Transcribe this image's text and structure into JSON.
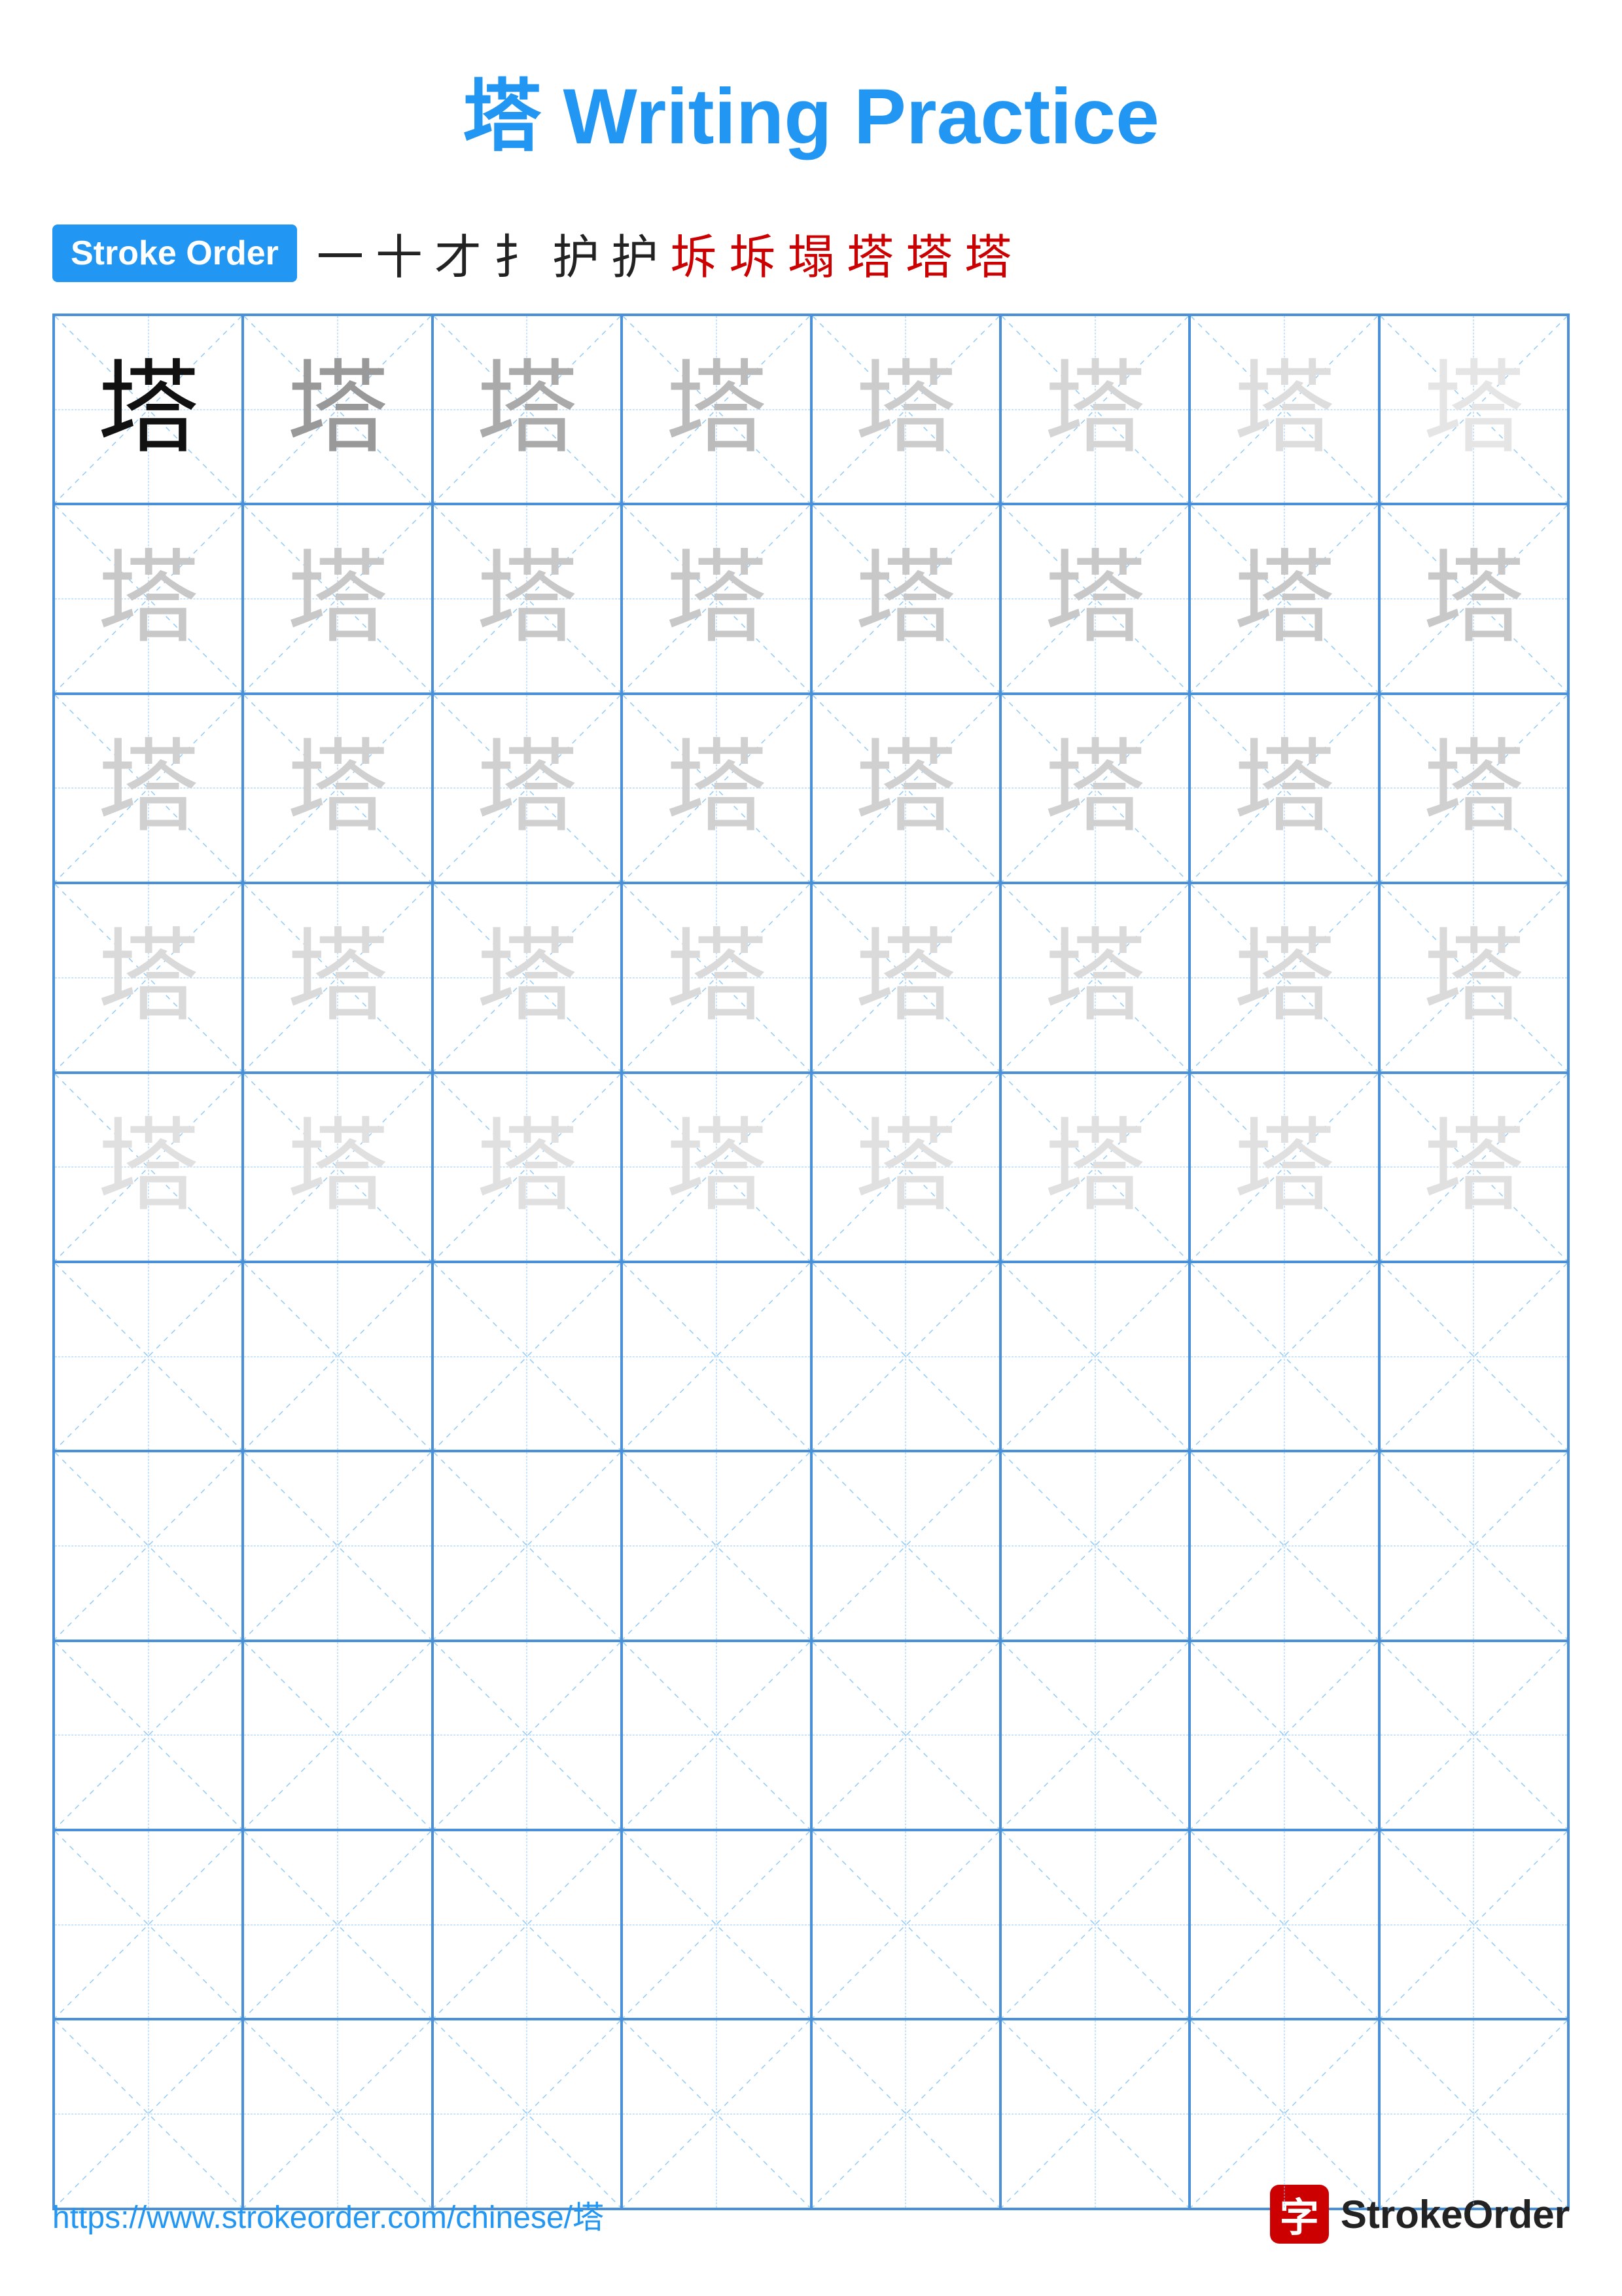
{
  "title": {
    "char": "塔",
    "subtitle": "Writing Practice",
    "full": "塔 Writing Practice"
  },
  "stroke_order": {
    "badge_label": "Stroke Order",
    "strokes": [
      "一",
      "十",
      "才",
      "扌",
      "护",
      "护",
      "坼",
      "坼",
      "塌",
      "塔",
      "塔",
      "塔"
    ]
  },
  "grid": {
    "character": "塔",
    "cols": 8,
    "rows": 10,
    "practice_rows": 5,
    "empty_rows": 5
  },
  "footer": {
    "url": "https://www.strokeorder.com/chinese/塔",
    "logo_char": "字",
    "logo_text": "StrokeOrder"
  }
}
